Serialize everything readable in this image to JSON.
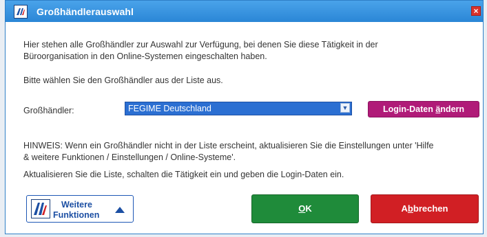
{
  "window": {
    "title": "Großhändlerauswahl",
    "close_label": "×"
  },
  "content": {
    "intro_line1": "Hier stehen alle Großhändler zur Auswahl zur Verfügung, bei denen Sie diese Tätigkeit in der",
    "intro_line2": "Büroorganisation in den Online-Systemen eingeschalten haben.",
    "instruction": "Bitte wählen Sie den Großhändler aus der Liste aus.",
    "wholesaler_label": "Großhändler:",
    "selected_wholesaler": "FEGIME Deutschland",
    "hint_line1": "HINWEIS: Wenn ein Großhändler nicht in der Liste erscheint, aktualisieren Sie die Einstellungen unter 'Hilfe",
    "hint_line2": "& weitere Funktionen / Einstellungen / Online-Systeme'.",
    "update_note": "Aktualisieren Sie die Liste, schalten die Tätigkeit ein und geben die Login-Daten ein."
  },
  "buttons": {
    "login_prefix": "Login-Daten ",
    "login_underlined": "ä",
    "login_suffix": "ndern",
    "more_line1": "Weitere",
    "more_line2": "Funktionen",
    "ok_underlined": "O",
    "ok_suffix": "K",
    "cancel_prefix": "A",
    "cancel_underlined": "b",
    "cancel_suffix": "brechen"
  },
  "colors": {
    "titlebar": "#2a86d6",
    "select_bg": "#2b6fd2",
    "login_button": "#b01b78",
    "ok_button": "#1f8b3a",
    "cancel_button": "#d11f24",
    "close_button": "#d9322b"
  },
  "icons": {
    "app": "app-logo-icon",
    "close": "close-icon",
    "dropdown": "chevron-down-icon",
    "more": "triangle-up-icon"
  }
}
